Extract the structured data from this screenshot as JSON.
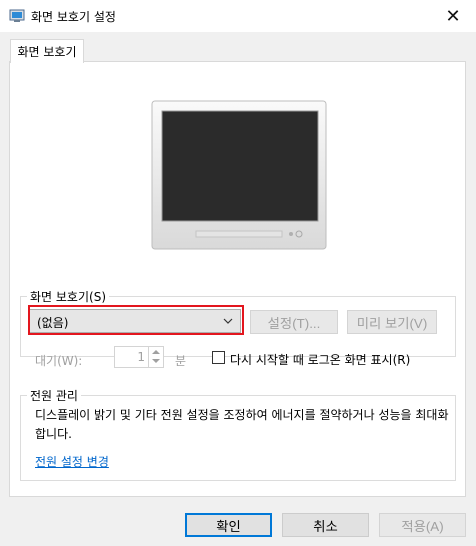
{
  "window": {
    "title": "화면 보호기 설정",
    "close_glyph": "✕"
  },
  "tab": {
    "label": "화면 보호기"
  },
  "screensaver": {
    "group_title": "화면 보호기(S)",
    "selected": "(없음)",
    "settings_label": "설정(T)...",
    "preview_label": "미리 보기(V)",
    "wait_label": "대기(W):",
    "wait_value": "1",
    "wait_unit": "분",
    "resume_checked": false,
    "resume_label": "다시 시작할 때 로그온 화면 표시(R)"
  },
  "power": {
    "group_title": "전원 관리",
    "description": "디스플레이 밝기 및 기타 전원 설정을 조정하여 에너지를 절약하거나 성능을 최대화합니다.",
    "link": "전원 설정 변경"
  },
  "footer": {
    "ok": "확인",
    "cancel": "취소",
    "apply": "적용(A)"
  },
  "colors": {
    "highlight": "#e3161e",
    "link": "#0066cc",
    "default_button_border": "#0078d7"
  }
}
